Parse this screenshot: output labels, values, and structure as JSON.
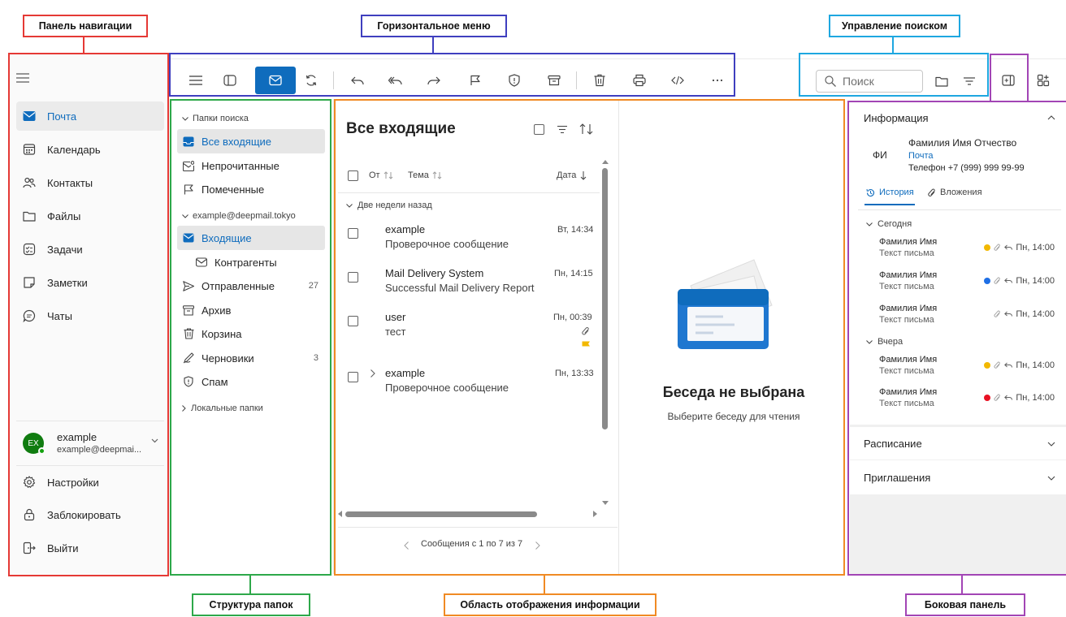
{
  "annotations": {
    "nav_panel": "Панель навигации",
    "horizontal_menu": "Горизонтальное меню",
    "search_control": "Управление поиском",
    "folder_structure": "Структура папок",
    "info_area": "Область отображения информации",
    "side_panel": "Боковая панель"
  },
  "colors": {
    "nav_zone": "#e53935",
    "menu_zone": "#3f3fbf",
    "search_zone": "#1ea7e0",
    "folder_zone": "#2ea84a",
    "info_zone": "#f08a24",
    "side_zone": "#a245b5",
    "accent": "#0f6cbd"
  },
  "nav": {
    "items": [
      {
        "label": "Почта",
        "icon": "mail-icon",
        "active": true
      },
      {
        "label": "Календарь",
        "icon": "calendar-icon"
      },
      {
        "label": "Контакты",
        "icon": "contacts-icon"
      },
      {
        "label": "Файлы",
        "icon": "folder-icon"
      },
      {
        "label": "Задачи",
        "icon": "tasks-icon"
      },
      {
        "label": "Заметки",
        "icon": "notes-icon"
      },
      {
        "label": "Чаты",
        "icon": "chat-icon"
      }
    ],
    "account": {
      "initials": "EX",
      "name": "example",
      "email": "example@deepmai..."
    },
    "bottom": [
      {
        "label": "Настройки",
        "icon": "settings-icon"
      },
      {
        "label": "Заблокировать",
        "icon": "lock-icon"
      },
      {
        "label": "Выйти",
        "icon": "logout-icon"
      }
    ]
  },
  "toolbar": {
    "icons": [
      "menu-icon",
      "panel-toggle-icon",
      "mail-icon",
      "refresh-icon",
      "reply-icon",
      "reply-all-icon",
      "forward-icon",
      "flag-icon",
      "shield-icon",
      "archive-icon",
      "delete-icon",
      "print-icon",
      "code-icon",
      "more-icon"
    ]
  },
  "search": {
    "placeholder": "Поиск"
  },
  "folders": {
    "search_group": "Папки поиска",
    "search_items": [
      {
        "label": "Все входящие",
        "icon": "inbox-icon",
        "active": true
      },
      {
        "label": "Непрочитанные",
        "icon": "unread-icon"
      },
      {
        "label": "Помеченные",
        "icon": "flag-icon"
      }
    ],
    "account_group": "example@deepmail.tokyo",
    "account_items": [
      {
        "label": "Входящие",
        "icon": "inbox-icon",
        "active": true,
        "count": ""
      },
      {
        "label": "Контрагенты",
        "icon": "mail-icon",
        "indent": true,
        "count": ""
      },
      {
        "label": "Отправленные",
        "icon": "send-icon",
        "count": "27"
      },
      {
        "label": "Архив",
        "icon": "archive-icon",
        "count": ""
      },
      {
        "label": "Корзина",
        "icon": "delete-icon",
        "count": ""
      },
      {
        "label": "Черновики",
        "icon": "drafts-icon",
        "count": "3"
      },
      {
        "label": "Спам",
        "icon": "spam-icon",
        "count": ""
      }
    ],
    "local_group": "Локальные папки"
  },
  "list": {
    "title": "Все входящие",
    "col_from": "От",
    "col_subject": "Тема",
    "col_date": "Дата",
    "group_label": "Две недели назад",
    "messages": [
      {
        "from": "example",
        "subject": "Проверочное сообщение",
        "date": "Вт, 14:34"
      },
      {
        "from": "Mail Delivery System",
        "subject": "Successful Mail Delivery Report",
        "date": "Пн, 14:15"
      },
      {
        "from": "user",
        "subject": "тест",
        "date": "Пн, 00:39"
      },
      {
        "from": "example",
        "subject": "Проверочное сообщение",
        "date": "Пн, 13:33"
      }
    ],
    "pagination": "Сообщения с 1 по 7 из 7"
  },
  "reading": {
    "title": "Беседа не выбрана",
    "subtitle": "Выберите беседу для чтения"
  },
  "side": {
    "info_title": "Информация",
    "contact": {
      "initials": "ФИ",
      "name": "Фамилия Имя Отчество",
      "link": "Почта",
      "phone": "Телефон +7 (999) 999 99-99"
    },
    "tab_history": "История",
    "tab_attachments": "Вложения",
    "today": "Сегодня",
    "yesterday": "Вчера",
    "rows": [
      {
        "name": "Фамилия Имя",
        "sub": "Текст письма",
        "time": "Пн, 14:00",
        "dot": "#f2b800"
      },
      {
        "name": "Фамилия Имя",
        "sub": "Текст письма",
        "time": "Пн, 14:00",
        "dot": "#1f6fe5"
      },
      {
        "name": "Фамилия Имя",
        "sub": "Текст письма",
        "time": "Пн, 14:00",
        "dot": ""
      },
      {
        "name": "Фамилия Имя",
        "sub": "Текст письма",
        "time": "Пн, 14:00",
        "dot": "#f2b800"
      },
      {
        "name": "Фамилия Имя",
        "sub": "Текст письма",
        "time": "Пн, 14:00",
        "dot": "#e81123"
      }
    ],
    "schedule": "Расписание",
    "invitations": "Приглашения"
  }
}
